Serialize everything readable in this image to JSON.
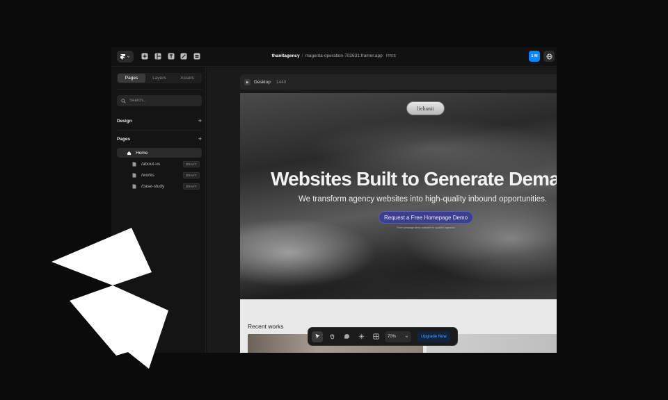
{
  "topbar": {
    "project_name": "thanitagency",
    "separator": "/",
    "domain": "magenta-operation-702631.framer.app",
    "plan": "FREE",
    "avatar_initials": "1 M",
    "tools": [
      "plus-icon",
      "layout-icon",
      "text-icon",
      "pen-icon",
      "database-icon"
    ]
  },
  "sidebar": {
    "tabs": [
      {
        "label": "Pages",
        "active": true
      },
      {
        "label": "Layers",
        "active": false
      },
      {
        "label": "Assets",
        "active": false
      }
    ],
    "search_placeholder": "Search...",
    "design_label": "Design",
    "pages_label": "Pages",
    "pages": [
      {
        "label": "Home",
        "icon": "home-icon",
        "active": true,
        "badge": ""
      },
      {
        "label": "/about-us",
        "icon": "page-icon",
        "active": false,
        "badge": "DRAFT"
      },
      {
        "label": "/works",
        "icon": "page-icon",
        "active": false,
        "badge": "DRAFT"
      },
      {
        "label": "/case-study",
        "icon": "page-icon",
        "active": false,
        "badge": "DRAFT"
      }
    ]
  },
  "canvas": {
    "frame_name": "Desktop",
    "frame_width": "1440",
    "site": {
      "nav_logo": "liehanit",
      "headline": "Websites Built to Generate Dema",
      "subline": "We transform agency websites into high-quality inbound opportunities.",
      "cta_label": "Request a Free Homepage Demo",
      "cta_note": "Free homepage demo available for qualified agencies",
      "recent_works": "Recent works"
    }
  },
  "toolbar": {
    "tools": [
      "cursor-icon",
      "hand-icon",
      "comment-icon",
      "sun-icon",
      "grid-icon"
    ],
    "zoom": "70%",
    "upgrade_label": "Upgrade Now"
  },
  "colors": {
    "accent_blue": "#0a84ff",
    "cta_purple": "#3b3f8c",
    "upgrade_text": "#4aa3ff"
  }
}
